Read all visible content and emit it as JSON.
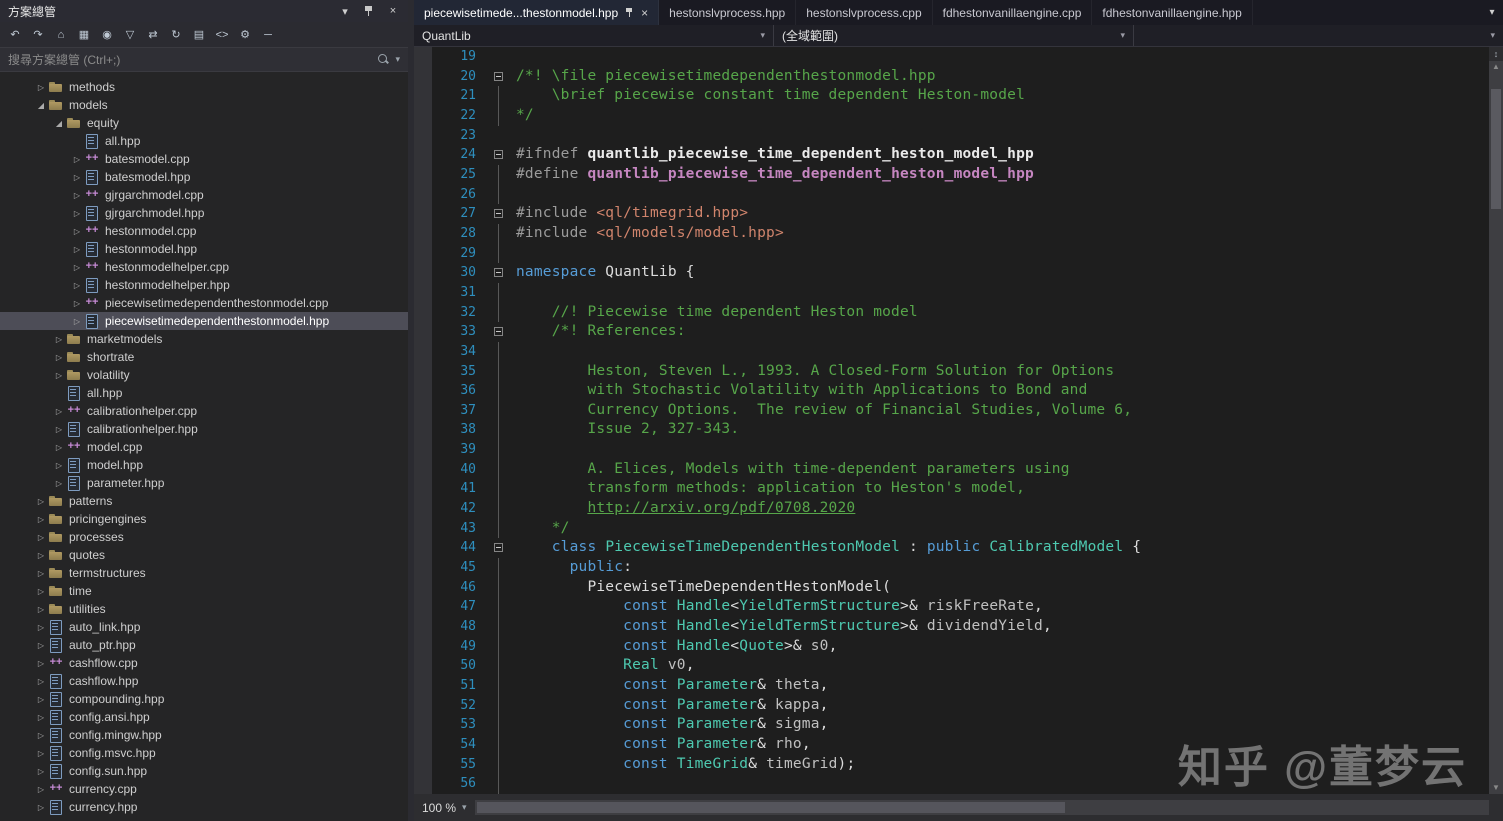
{
  "colors": {
    "keyword": "#569cd6",
    "type": "#4ec9b0",
    "comment": "#57a64a",
    "string": "#d0846c",
    "macro": "#c586c0",
    "line_number": "#2e8fbe",
    "editor_bg": "#1e1e1e",
    "panel_bg": "#252526"
  },
  "solution_explorer": {
    "title": "方案總管",
    "title_buttons": [
      {
        "name": "window-position-icon",
        "glyph": "▾"
      },
      {
        "name": "pin-icon",
        "glyph": ""
      },
      {
        "name": "close-icon",
        "glyph": "×"
      }
    ],
    "toolbar": [
      {
        "name": "back-button",
        "glyph": "↶"
      },
      {
        "name": "forward-button",
        "glyph": "↷"
      },
      {
        "name": "home-button",
        "glyph": "⌂"
      },
      {
        "name": "switch-views-button",
        "glyph": "▦"
      },
      {
        "name": "pending-changes-filter-button",
        "glyph": "◉"
      },
      {
        "name": "filter-button",
        "glyph": "▽"
      },
      {
        "name": "sync-with-active-document-button",
        "glyph": "⇄"
      },
      {
        "name": "refresh-button",
        "glyph": "↻"
      },
      {
        "name": "show-all-files-button",
        "glyph": "▤"
      },
      {
        "name": "view-code-button",
        "glyph": "<>"
      },
      {
        "name": "properties-button",
        "glyph": "⚙"
      },
      {
        "name": "collapse-all-button",
        "glyph": "─"
      }
    ],
    "search_placeholder": "搜尋方案總管 (Ctrl+;)",
    "tree": [
      {
        "label": "methods",
        "indent": 1,
        "type": "folder",
        "arrow": "collapsed"
      },
      {
        "label": "models",
        "indent": 1,
        "type": "folder",
        "arrow": "expanded"
      },
      {
        "label": "equity",
        "indent": 2,
        "type": "folder",
        "arrow": "expanded"
      },
      {
        "label": "all.hpp",
        "indent": 3,
        "type": "hpp",
        "arrow": "none"
      },
      {
        "label": "batesmodel.cpp",
        "indent": 3,
        "type": "cpp",
        "arrow": "collapsed"
      },
      {
        "label": "batesmodel.hpp",
        "indent": 3,
        "type": "hpp",
        "arrow": "collapsed"
      },
      {
        "label": "gjrgarchmodel.cpp",
        "indent": 3,
        "type": "cpp",
        "arrow": "collapsed"
      },
      {
        "label": "gjrgarchmodel.hpp",
        "indent": 3,
        "type": "hpp",
        "arrow": "collapsed"
      },
      {
        "label": "hestonmodel.cpp",
        "indent": 3,
        "type": "cpp",
        "arrow": "collapsed"
      },
      {
        "label": "hestonmodel.hpp",
        "indent": 3,
        "type": "hpp",
        "arrow": "collapsed"
      },
      {
        "label": "hestonmodelhelper.cpp",
        "indent": 3,
        "type": "cpp",
        "arrow": "collapsed"
      },
      {
        "label": "hestonmodelhelper.hpp",
        "indent": 3,
        "type": "hpp",
        "arrow": "collapsed"
      },
      {
        "label": "piecewisetimedependenthestonmodel.cpp",
        "indent": 3,
        "type": "cpp",
        "arrow": "collapsed"
      },
      {
        "label": "piecewisetimedependenthestonmodel.hpp",
        "indent": 3,
        "type": "hpp",
        "arrow": "collapsed",
        "selected": true
      },
      {
        "label": "marketmodels",
        "indent": 2,
        "type": "folder",
        "arrow": "collapsed"
      },
      {
        "label": "shortrate",
        "indent": 2,
        "type": "folder",
        "arrow": "collapsed"
      },
      {
        "label": "volatility",
        "indent": 2,
        "type": "folder",
        "arrow": "collapsed"
      },
      {
        "label": "all.hpp",
        "indent": 2,
        "type": "hpp",
        "arrow": "none"
      },
      {
        "label": "calibrationhelper.cpp",
        "indent": 2,
        "type": "cpp",
        "arrow": "collapsed"
      },
      {
        "label": "calibrationhelper.hpp",
        "indent": 2,
        "type": "hpp",
        "arrow": "collapsed"
      },
      {
        "label": "model.cpp",
        "indent": 2,
        "type": "cpp",
        "arrow": "collapsed"
      },
      {
        "label": "model.hpp",
        "indent": 2,
        "type": "hpp",
        "arrow": "collapsed"
      },
      {
        "label": "parameter.hpp",
        "indent": 2,
        "type": "hpp",
        "arrow": "collapsed"
      },
      {
        "label": "patterns",
        "indent": 1,
        "type": "folder",
        "arrow": "collapsed"
      },
      {
        "label": "pricingengines",
        "indent": 1,
        "type": "folder",
        "arrow": "collapsed"
      },
      {
        "label": "processes",
        "indent": 1,
        "type": "folder",
        "arrow": "collapsed"
      },
      {
        "label": "quotes",
        "indent": 1,
        "type": "folder",
        "arrow": "collapsed"
      },
      {
        "label": "termstructures",
        "indent": 1,
        "type": "folder",
        "arrow": "collapsed"
      },
      {
        "label": "time",
        "indent": 1,
        "type": "folder",
        "arrow": "collapsed"
      },
      {
        "label": "utilities",
        "indent": 1,
        "type": "folder",
        "arrow": "collapsed"
      },
      {
        "label": "auto_link.hpp",
        "indent": 1,
        "type": "hpp",
        "arrow": "collapsed"
      },
      {
        "label": "auto_ptr.hpp",
        "indent": 1,
        "type": "hpp",
        "arrow": "collapsed"
      },
      {
        "label": "cashflow.cpp",
        "indent": 1,
        "type": "cpp",
        "arrow": "collapsed"
      },
      {
        "label": "cashflow.hpp",
        "indent": 1,
        "type": "hpp",
        "arrow": "collapsed"
      },
      {
        "label": "compounding.hpp",
        "indent": 1,
        "type": "hpp",
        "arrow": "collapsed"
      },
      {
        "label": "config.ansi.hpp",
        "indent": 1,
        "type": "hpp",
        "arrow": "collapsed"
      },
      {
        "label": "config.mingw.hpp",
        "indent": 1,
        "type": "hpp",
        "arrow": "collapsed"
      },
      {
        "label": "config.msvc.hpp",
        "indent": 1,
        "type": "hpp",
        "arrow": "collapsed"
      },
      {
        "label": "config.sun.hpp",
        "indent": 1,
        "type": "hpp",
        "arrow": "collapsed"
      },
      {
        "label": "currency.cpp",
        "indent": 1,
        "type": "cpp",
        "arrow": "collapsed"
      },
      {
        "label": "currency.hpp",
        "indent": 1,
        "type": "hpp",
        "arrow": "collapsed"
      }
    ]
  },
  "tabs": [
    {
      "label": "piecewisetimede...thestonmodel.hpp",
      "active": true
    },
    {
      "label": "hestonslvprocess.hpp"
    },
    {
      "label": "hestonslvprocess.cpp"
    },
    {
      "label": "fdhestonvanillaengine.cpp"
    },
    {
      "label": "fdhestonvanillaengine.hpp"
    }
  ],
  "tab_strip": {
    "overflow_button_glyph": "▾"
  },
  "navbar": {
    "dropdowns": [
      {
        "name": "project-dropdown",
        "label": "QuantLib"
      },
      {
        "name": "scope-dropdown",
        "label": "(全域範圍)"
      },
      {
        "name": "member-dropdown",
        "label": ""
      }
    ]
  },
  "editor": {
    "lines": [
      {
        "n": 19,
        "f": "",
        "s": []
      },
      {
        "n": 20,
        "f": "b",
        "s": [
          [
            "cm",
            "/*! \\file piecewisetimedependenthestonmodel.hpp"
          ]
        ]
      },
      {
        "n": 21,
        "f": "l",
        "s": [
          [
            "cm",
            "    \\brief piecewise constant time dependent Heston-model"
          ]
        ]
      },
      {
        "n": 22,
        "f": "l",
        "s": [
          [
            "cm",
            "*/"
          ]
        ]
      },
      {
        "n": 23,
        "f": "",
        "s": []
      },
      {
        "n": 24,
        "f": "b",
        "s": [
          [
            "pp",
            "#ifndef "
          ],
          [
            "b",
            "quantlib_piecewise_time_dependent_heston_model_hpp"
          ]
        ]
      },
      {
        "n": 25,
        "f": "l",
        "s": [
          [
            "pp",
            "#define "
          ],
          [
            "mac",
            "quantlib_piecewise_time_dependent_heston_model_hpp"
          ]
        ]
      },
      {
        "n": 26,
        "f": "l",
        "s": []
      },
      {
        "n": 27,
        "f": "b",
        "s": [
          [
            "pp",
            "#include "
          ],
          [
            "st",
            "<ql/timegrid.hpp>"
          ]
        ]
      },
      {
        "n": 28,
        "f": "l",
        "s": [
          [
            "pp",
            "#include "
          ],
          [
            "st",
            "<ql/models/model.hpp>"
          ]
        ]
      },
      {
        "n": 29,
        "f": "l",
        "s": []
      },
      {
        "n": 30,
        "f": "b",
        "s": [
          [
            "kw",
            "namespace"
          ],
          [
            "d",
            " QuantLib {"
          ]
        ]
      },
      {
        "n": 31,
        "f": "l",
        "s": []
      },
      {
        "n": 32,
        "f": "l",
        "s": [
          [
            "cm",
            "    //! Piecewise time dependent Heston model"
          ]
        ]
      },
      {
        "n": 33,
        "f": "b",
        "s": [
          [
            "cm",
            "    /*! References:"
          ]
        ]
      },
      {
        "n": 34,
        "f": "l",
        "s": []
      },
      {
        "n": 35,
        "f": "l",
        "s": [
          [
            "cm",
            "        Heston, Steven L., 1993. A Closed-Form Solution for Options"
          ]
        ]
      },
      {
        "n": 36,
        "f": "l",
        "s": [
          [
            "cm",
            "        with Stochastic Volatility with Applications to Bond and"
          ]
        ]
      },
      {
        "n": 37,
        "f": "l",
        "s": [
          [
            "cm",
            "        Currency Options.  The review of Financial Studies, Volume 6,"
          ]
        ]
      },
      {
        "n": 38,
        "f": "l",
        "s": [
          [
            "cm",
            "        Issue 2, 327-343."
          ]
        ]
      },
      {
        "n": 39,
        "f": "l",
        "s": []
      },
      {
        "n": 40,
        "f": "l",
        "s": [
          [
            "cm",
            "        A. Elices, Models with time-dependent parameters using"
          ]
        ]
      },
      {
        "n": 41,
        "f": "l",
        "s": [
          [
            "cm",
            "        transform methods: application to Heston's model,"
          ]
        ]
      },
      {
        "n": 42,
        "f": "l",
        "s": [
          [
            "cm",
            "        "
          ],
          [
            "lnk",
            "http://arxiv.org/pdf/0708.2020"
          ]
        ]
      },
      {
        "n": 43,
        "f": "l",
        "s": [
          [
            "cm",
            "    */"
          ]
        ]
      },
      {
        "n": 44,
        "f": "b",
        "s": [
          [
            "d",
            "    "
          ],
          [
            "kw",
            "class"
          ],
          [
            "d",
            " "
          ],
          [
            "ty",
            "PiecewiseTimeDependentHestonModel"
          ],
          [
            "d",
            " : "
          ],
          [
            "kw",
            "public"
          ],
          [
            "d",
            " "
          ],
          [
            "ty",
            "CalibratedModel"
          ],
          [
            "d",
            " {"
          ]
        ]
      },
      {
        "n": 45,
        "f": "l",
        "s": [
          [
            "d",
            "      "
          ],
          [
            "kw",
            "public"
          ],
          [
            "d",
            ":"
          ]
        ]
      },
      {
        "n": 46,
        "f": "l",
        "s": [
          [
            "d",
            "        PiecewiseTimeDependentHestonModel("
          ]
        ]
      },
      {
        "n": 47,
        "f": "l",
        "s": [
          [
            "d",
            "            "
          ],
          [
            "kw",
            "const"
          ],
          [
            "d",
            " "
          ],
          [
            "ty",
            "Handle"
          ],
          [
            "d",
            "<"
          ],
          [
            "ty",
            "YieldTermStructure"
          ],
          [
            "d",
            ">& "
          ],
          [
            "pr",
            "riskFreeRate"
          ],
          [
            "d",
            ","
          ]
        ]
      },
      {
        "n": 48,
        "f": "l",
        "s": [
          [
            "d",
            "            "
          ],
          [
            "kw",
            "const"
          ],
          [
            "d",
            " "
          ],
          [
            "ty",
            "Handle"
          ],
          [
            "d",
            "<"
          ],
          [
            "ty",
            "YieldTermStructure"
          ],
          [
            "d",
            ">& "
          ],
          [
            "pr",
            "dividendYield"
          ],
          [
            "d",
            ","
          ]
        ]
      },
      {
        "n": 49,
        "f": "l",
        "s": [
          [
            "d",
            "            "
          ],
          [
            "kw",
            "const"
          ],
          [
            "d",
            " "
          ],
          [
            "ty",
            "Handle"
          ],
          [
            "d",
            "<"
          ],
          [
            "ty",
            "Quote"
          ],
          [
            "d",
            ">& "
          ],
          [
            "pr",
            "s0"
          ],
          [
            "d",
            ","
          ]
        ]
      },
      {
        "n": 50,
        "f": "l",
        "s": [
          [
            "d",
            "            "
          ],
          [
            "ty",
            "Real"
          ],
          [
            "d",
            " "
          ],
          [
            "pr",
            "v0"
          ],
          [
            "d",
            ","
          ]
        ]
      },
      {
        "n": 51,
        "f": "l",
        "s": [
          [
            "d",
            "            "
          ],
          [
            "kw",
            "const"
          ],
          [
            "d",
            " "
          ],
          [
            "ty",
            "Parameter"
          ],
          [
            "d",
            "& "
          ],
          [
            "pr",
            "theta"
          ],
          [
            "d",
            ","
          ]
        ]
      },
      {
        "n": 52,
        "f": "l",
        "s": [
          [
            "d",
            "            "
          ],
          [
            "kw",
            "const"
          ],
          [
            "d",
            " "
          ],
          [
            "ty",
            "Parameter"
          ],
          [
            "d",
            "& "
          ],
          [
            "pr",
            "kappa"
          ],
          [
            "d",
            ","
          ]
        ]
      },
      {
        "n": 53,
        "f": "l",
        "s": [
          [
            "d",
            "            "
          ],
          [
            "kw",
            "const"
          ],
          [
            "d",
            " "
          ],
          [
            "ty",
            "Parameter"
          ],
          [
            "d",
            "& "
          ],
          [
            "pr",
            "sigma"
          ],
          [
            "d",
            ","
          ]
        ]
      },
      {
        "n": 54,
        "f": "l",
        "s": [
          [
            "d",
            "            "
          ],
          [
            "kw",
            "const"
          ],
          [
            "d",
            " "
          ],
          [
            "ty",
            "Parameter"
          ],
          [
            "d",
            "& "
          ],
          [
            "pr",
            "rho"
          ],
          [
            "d",
            ","
          ]
        ]
      },
      {
        "n": 55,
        "f": "l",
        "s": [
          [
            "d",
            "            "
          ],
          [
            "kw",
            "const"
          ],
          [
            "d",
            " "
          ],
          [
            "ty",
            "TimeGrid"
          ],
          [
            "d",
            "& "
          ],
          [
            "pr",
            "timeGrid"
          ],
          [
            "d",
            ");"
          ]
        ]
      },
      {
        "n": 56,
        "f": "l",
        "s": []
      }
    ]
  },
  "zoom_label": "100 %",
  "watermark": "知乎 @董梦云"
}
